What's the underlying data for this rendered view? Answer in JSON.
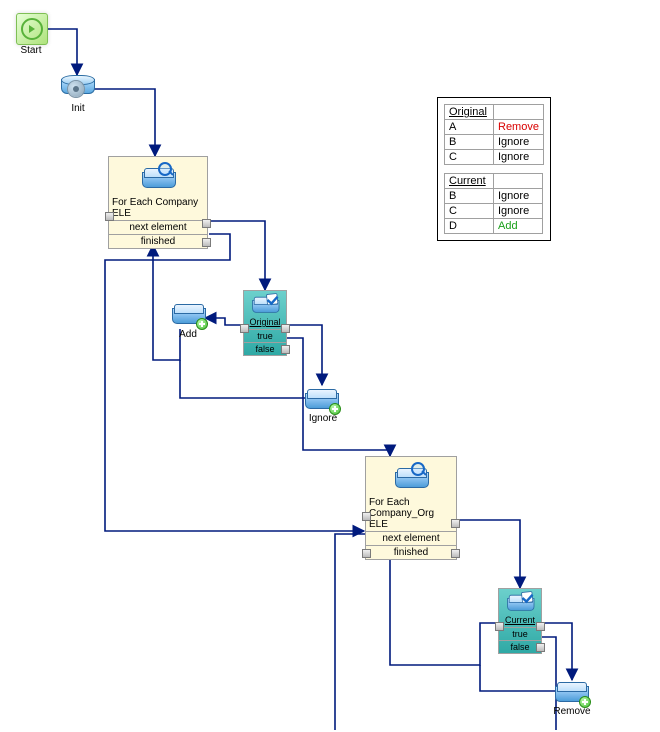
{
  "start": {
    "label": "Start"
  },
  "init": {
    "label": "Init"
  },
  "forEach": {
    "label": "For Each Company\nELE",
    "row1": "next element",
    "row2": "finished"
  },
  "add": {
    "label": "Add"
  },
  "original": {
    "label": "Original",
    "row1": "true",
    "row2": "false"
  },
  "ignore": {
    "label": "Ignore"
  },
  "forEachOrg": {
    "label": "For Each\nCompany_Org ELE",
    "row1": "next element",
    "row2": "finished"
  },
  "current": {
    "label": "Current",
    "row1": "true",
    "row2": "false"
  },
  "remove": {
    "label": "Remove"
  },
  "legend": {
    "original": {
      "title": "Original",
      "rows": [
        {
          "k": "A",
          "v": "Remove",
          "cls": "remove"
        },
        {
          "k": "B",
          "v": "Ignore",
          "cls": ""
        },
        {
          "k": "C",
          "v": "Ignore",
          "cls": ""
        }
      ]
    },
    "current": {
      "title": "Current",
      "rows": [
        {
          "k": "B",
          "v": "Ignore",
          "cls": ""
        },
        {
          "k": "C",
          "v": "Ignore",
          "cls": ""
        },
        {
          "k": "D",
          "v": "Add",
          "cls": "add"
        }
      ]
    }
  }
}
